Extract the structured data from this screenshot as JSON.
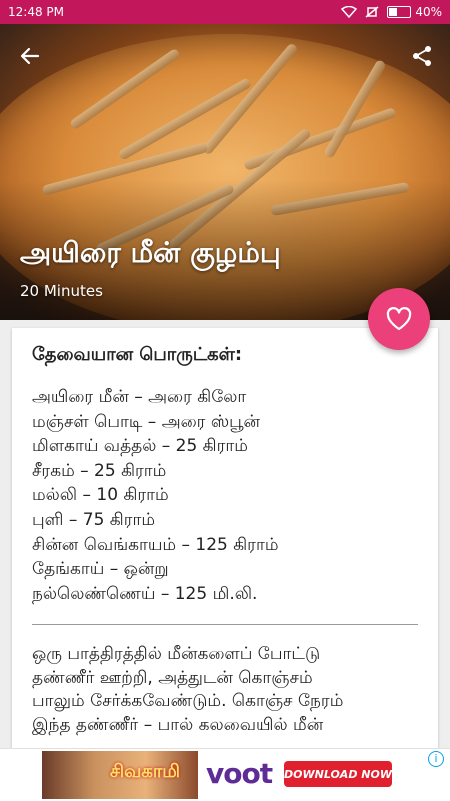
{
  "status_bar": {
    "time": "12:48 PM",
    "battery": "40%",
    "battery_level": 0.4,
    "icons": [
      "wifi-icon",
      "mute-icon",
      "battery-icon"
    ]
  },
  "header": {
    "back_icon": "back-arrow-icon",
    "share_icon": "share-icon",
    "title": "அயிரை மீன் குழம்பு",
    "duration": "20 Minutes"
  },
  "favorite_icon": "heart-icon",
  "ingredients": {
    "heading": "தேவையான பொருட்கள்:",
    "items": [
      "அயிரை மீன் – அரை கிலோ",
      "மஞ்சள் பொடி – அரை ஸ்பூன்",
      "மிளகாய் வத்தல் – 25 கிராம்",
      "சீரகம் – 25 கிராம்",
      "மல்லி – 10 கிராம்",
      "புளி – 75 கிராம்",
      "சின்ன வெங்காயம் – 125 கிராம்",
      "தேங்காய் – ஒன்று",
      "நல்லெண்ணெய் – 125 மி.லி."
    ]
  },
  "method": {
    "lines": [
      "ஒரு பாத்திரத்தில் மீன்களைப் போட்டு",
      "தண்ணீர் ஊற்றி, அத்துடன் கொஞ்சம்",
      "பாலும் சேர்க்கவேண்டும். கொஞ்ச நேரம்",
      "இந்த தண்ணீர் – பால் கலவையில் மீன்"
    ]
  },
  "ad": {
    "image_text": "சிவகாமி",
    "brand": "voot",
    "cta": "DOWNLOAD NOW"
  },
  "colors": {
    "status_bar": "#c2185b",
    "fab": "#ec407a",
    "ad_brand": "#5e2b97",
    "ad_cta": "#e0202f"
  }
}
